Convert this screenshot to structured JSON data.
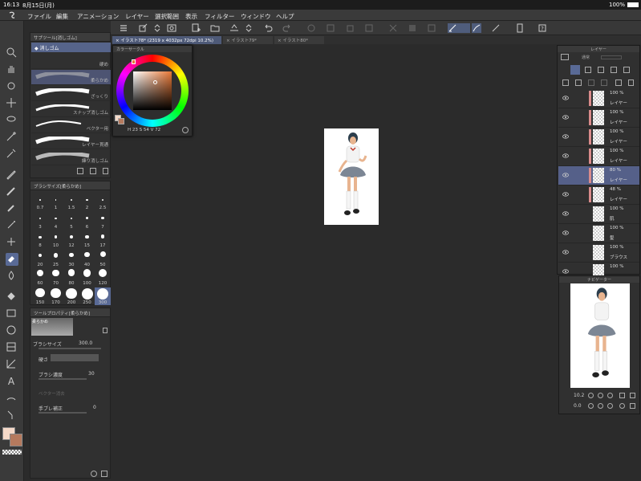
{
  "statusbar": {
    "time": "16:13",
    "date": "8月15日(月)",
    "battery": "100%"
  },
  "menubar": {
    "items": [
      "ファイル",
      "編集",
      "アニメーション",
      "レイヤー",
      "選択範囲",
      "表示",
      "フィルター",
      "ウィンドウ",
      "ヘルプ"
    ]
  },
  "tabs": [
    {
      "label": "イラスト78* (2319 x 4032px 72dpi 10.2%)",
      "active": true
    },
    {
      "label": "イラスト79*",
      "active": false
    },
    {
      "label": "イラスト80*",
      "active": false
    }
  ],
  "subtool": {
    "title": "サブツール[消しゴム]",
    "group": "消しゴム",
    "brushes": [
      "硬め",
      "柔らかめ",
      "ざっくり",
      "スナップ消しゴム",
      "ベクター用",
      "レイヤー貫通",
      "練り消しゴム"
    ]
  },
  "brushsize": {
    "title": "ブラシサイズ[柔らかめ]",
    "sizes": [
      "0.7",
      "1",
      "1.5",
      "2",
      "2.5",
      "3",
      "4",
      "5",
      "6",
      "7",
      "8",
      "10",
      "12",
      "15",
      "17",
      "20",
      "25",
      "30",
      "40",
      "50",
      "60",
      "70",
      "80",
      "100",
      "120",
      "150",
      "170",
      "200",
      "250",
      "300"
    ],
    "selected": "300"
  },
  "toolprop": {
    "title": "ツールプロパティ[柔らかめ]",
    "preset_name": "柔らかめ",
    "brush_size_label": "ブラシサイズ",
    "brush_size_value": "300.0",
    "hardness_label": "硬さ",
    "density_label": "ブラシ濃度",
    "density_value": "30",
    "vector_label": "ベクター消去",
    "stabilization_label": "手ブレ補正",
    "stabilization_value": "0"
  },
  "colorcircle": {
    "title": "カラーサークル",
    "h": "23",
    "s": "54",
    "v": "72"
  },
  "layerpanel": {
    "title": "レイヤー",
    "blend_mode": "通常",
    "layers": [
      {
        "pct": "100 %",
        "name": "レイヤー",
        "red": true,
        "active": false
      },
      {
        "pct": "100 %",
        "name": "レイヤー",
        "red": true,
        "active": false
      },
      {
        "pct": "100 %",
        "name": "レイヤー",
        "red": true,
        "active": false
      },
      {
        "pct": "100 %",
        "name": "レイヤー",
        "red": true,
        "active": false
      },
      {
        "pct": "80 %",
        "name": "レイヤー",
        "red": true,
        "active": true
      },
      {
        "pct": "48 %",
        "name": "レイヤー",
        "red": true,
        "active": false
      },
      {
        "pct": "100 %",
        "name": "肌",
        "red": false,
        "active": false
      },
      {
        "pct": "100 %",
        "name": "髪",
        "red": false,
        "active": false
      },
      {
        "pct": "100 %",
        "name": "ブラウス",
        "red": false,
        "active": false
      },
      {
        "pct": "100 %",
        "name": "",
        "red": false,
        "active": false
      }
    ]
  },
  "navigator": {
    "title": "ナビゲーター",
    "zoom": "10.2",
    "rotation": "0.0"
  },
  "colors": {
    "main": "#f5d9c8",
    "sub": "#b57a5e",
    "accent": "#596a96"
  }
}
